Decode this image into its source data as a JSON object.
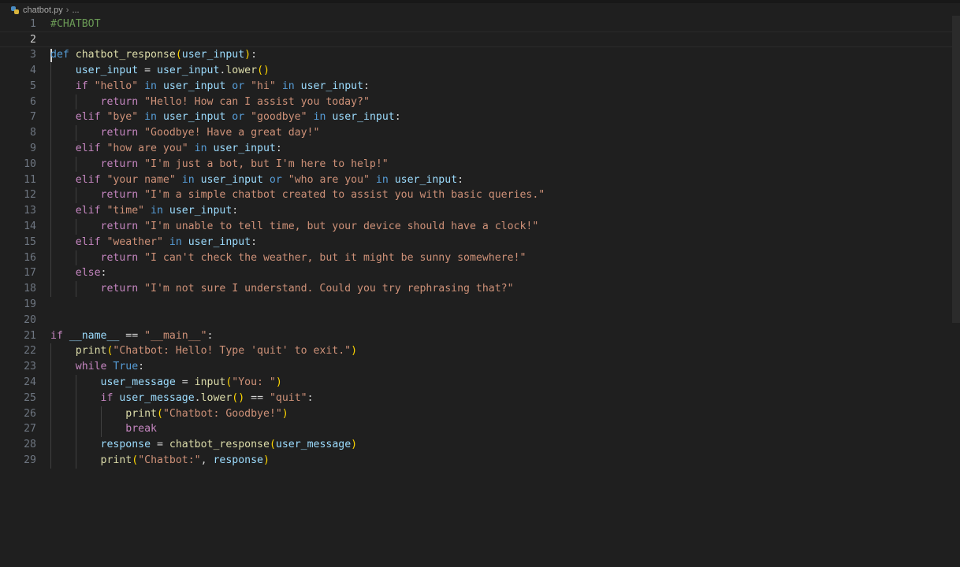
{
  "breadcrumb": {
    "file": "chatbot.py",
    "separator": "›",
    "more": "..."
  },
  "editor": {
    "active_line": 2,
    "lines": [
      {
        "n": "1",
        "tokens": [
          {
            "t": "#CHATBOT",
            "c": "cm"
          }
        ]
      },
      {
        "n": "2",
        "tokens": []
      },
      {
        "n": "3",
        "tokens": [
          {
            "t": "def ",
            "c": "kw2"
          },
          {
            "t": "chatbot_response",
            "c": "fn"
          },
          {
            "t": "(",
            "c": "p1"
          },
          {
            "t": "user_input",
            "c": "var"
          },
          {
            "t": ")",
            "c": "p1"
          },
          {
            "t": ":",
            "c": ""
          }
        ]
      },
      {
        "n": "4",
        "tokens": [
          {
            "t": "    ",
            "c": ""
          },
          {
            "t": "user_input",
            "c": "var"
          },
          {
            "t": " = ",
            "c": ""
          },
          {
            "t": "user_input",
            "c": "var"
          },
          {
            "t": ".",
            "c": ""
          },
          {
            "t": "lower",
            "c": "fn"
          },
          {
            "t": "()",
            "c": "p1"
          }
        ]
      },
      {
        "n": "5",
        "tokens": [
          {
            "t": "    ",
            "c": ""
          },
          {
            "t": "if ",
            "c": "kw"
          },
          {
            "t": "\"hello\"",
            "c": "str"
          },
          {
            "t": " in ",
            "c": "kw2"
          },
          {
            "t": "user_input",
            "c": "var"
          },
          {
            "t": " or ",
            "c": "kw2"
          },
          {
            "t": "\"hi\"",
            "c": "str"
          },
          {
            "t": " in ",
            "c": "kw2"
          },
          {
            "t": "user_input",
            "c": "var"
          },
          {
            "t": ":",
            "c": ""
          }
        ]
      },
      {
        "n": "6",
        "tokens": [
          {
            "t": "        ",
            "c": ""
          },
          {
            "t": "return ",
            "c": "kw"
          },
          {
            "t": "\"Hello! How can I assist you today?\"",
            "c": "str"
          }
        ]
      },
      {
        "n": "7",
        "tokens": [
          {
            "t": "    ",
            "c": ""
          },
          {
            "t": "elif ",
            "c": "kw"
          },
          {
            "t": "\"bye\"",
            "c": "str"
          },
          {
            "t": " in ",
            "c": "kw2"
          },
          {
            "t": "user_input",
            "c": "var"
          },
          {
            "t": " or ",
            "c": "kw2"
          },
          {
            "t": "\"goodbye\"",
            "c": "str"
          },
          {
            "t": " in ",
            "c": "kw2"
          },
          {
            "t": "user_input",
            "c": "var"
          },
          {
            "t": ":",
            "c": ""
          }
        ]
      },
      {
        "n": "8",
        "tokens": [
          {
            "t": "        ",
            "c": ""
          },
          {
            "t": "return ",
            "c": "kw"
          },
          {
            "t": "\"Goodbye! Have a great day!\"",
            "c": "str"
          }
        ]
      },
      {
        "n": "9",
        "tokens": [
          {
            "t": "    ",
            "c": ""
          },
          {
            "t": "elif ",
            "c": "kw"
          },
          {
            "t": "\"how are you\"",
            "c": "str"
          },
          {
            "t": " in ",
            "c": "kw2"
          },
          {
            "t": "user_input",
            "c": "var"
          },
          {
            "t": ":",
            "c": ""
          }
        ]
      },
      {
        "n": "10",
        "tokens": [
          {
            "t": "        ",
            "c": ""
          },
          {
            "t": "return ",
            "c": "kw"
          },
          {
            "t": "\"I'm just a bot, but I'm here to help!\"",
            "c": "str"
          }
        ]
      },
      {
        "n": "11",
        "tokens": [
          {
            "t": "    ",
            "c": ""
          },
          {
            "t": "elif ",
            "c": "kw"
          },
          {
            "t": "\"your name\"",
            "c": "str"
          },
          {
            "t": " in ",
            "c": "kw2"
          },
          {
            "t": "user_input",
            "c": "var"
          },
          {
            "t": " or ",
            "c": "kw2"
          },
          {
            "t": "\"who are you\"",
            "c": "str"
          },
          {
            "t": " in ",
            "c": "kw2"
          },
          {
            "t": "user_input",
            "c": "var"
          },
          {
            "t": ":",
            "c": ""
          }
        ]
      },
      {
        "n": "12",
        "tokens": [
          {
            "t": "        ",
            "c": ""
          },
          {
            "t": "return ",
            "c": "kw"
          },
          {
            "t": "\"I'm a simple chatbot created to assist you with basic queries.\"",
            "c": "str"
          }
        ]
      },
      {
        "n": "13",
        "tokens": [
          {
            "t": "    ",
            "c": ""
          },
          {
            "t": "elif ",
            "c": "kw"
          },
          {
            "t": "\"time\"",
            "c": "str"
          },
          {
            "t": " in ",
            "c": "kw2"
          },
          {
            "t": "user_input",
            "c": "var"
          },
          {
            "t": ":",
            "c": ""
          }
        ]
      },
      {
        "n": "14",
        "tokens": [
          {
            "t": "        ",
            "c": ""
          },
          {
            "t": "return ",
            "c": "kw"
          },
          {
            "t": "\"I'm unable to tell time, but your device should have a clock!\"",
            "c": "str"
          }
        ]
      },
      {
        "n": "15",
        "tokens": [
          {
            "t": "    ",
            "c": ""
          },
          {
            "t": "elif ",
            "c": "kw"
          },
          {
            "t": "\"weather\"",
            "c": "str"
          },
          {
            "t": " in ",
            "c": "kw2"
          },
          {
            "t": "user_input",
            "c": "var"
          },
          {
            "t": ":",
            "c": ""
          }
        ]
      },
      {
        "n": "16",
        "tokens": [
          {
            "t": "        ",
            "c": ""
          },
          {
            "t": "return ",
            "c": "kw"
          },
          {
            "t": "\"I can't check the weather, but it might be sunny somewhere!\"",
            "c": "str"
          }
        ]
      },
      {
        "n": "17",
        "tokens": [
          {
            "t": "    ",
            "c": ""
          },
          {
            "t": "else",
            "c": "kw"
          },
          {
            "t": ":",
            "c": ""
          }
        ]
      },
      {
        "n": "18",
        "tokens": [
          {
            "t": "        ",
            "c": ""
          },
          {
            "t": "return ",
            "c": "kw"
          },
          {
            "t": "\"I'm not sure I understand. Could you try rephrasing that?\"",
            "c": "str"
          }
        ]
      },
      {
        "n": "19",
        "tokens": []
      },
      {
        "n": "20",
        "tokens": []
      },
      {
        "n": "21",
        "tokens": [
          {
            "t": "if ",
            "c": "kw"
          },
          {
            "t": "__name__",
            "c": "var"
          },
          {
            "t": " == ",
            "c": ""
          },
          {
            "t": "\"__main__\"",
            "c": "str"
          },
          {
            "t": ":",
            "c": ""
          }
        ]
      },
      {
        "n": "22",
        "tokens": [
          {
            "t": "    ",
            "c": ""
          },
          {
            "t": "print",
            "c": "fn"
          },
          {
            "t": "(",
            "c": "p1"
          },
          {
            "t": "\"Chatbot: Hello! Type 'quit' to exit.\"",
            "c": "str"
          },
          {
            "t": ")",
            "c": "p1"
          }
        ]
      },
      {
        "n": "23",
        "tokens": [
          {
            "t": "    ",
            "c": ""
          },
          {
            "t": "while ",
            "c": "kw"
          },
          {
            "t": "True",
            "c": "kw2"
          },
          {
            "t": ":",
            "c": ""
          }
        ]
      },
      {
        "n": "24",
        "tokens": [
          {
            "t": "        ",
            "c": ""
          },
          {
            "t": "user_message",
            "c": "var"
          },
          {
            "t": " = ",
            "c": ""
          },
          {
            "t": "input",
            "c": "fn"
          },
          {
            "t": "(",
            "c": "p1"
          },
          {
            "t": "\"You: \"",
            "c": "str"
          },
          {
            "t": ")",
            "c": "p1"
          }
        ]
      },
      {
        "n": "25",
        "tokens": [
          {
            "t": "        ",
            "c": ""
          },
          {
            "t": "if ",
            "c": "kw"
          },
          {
            "t": "user_message",
            "c": "var"
          },
          {
            "t": ".",
            "c": ""
          },
          {
            "t": "lower",
            "c": "fn"
          },
          {
            "t": "()",
            "c": "p1"
          },
          {
            "t": " == ",
            "c": ""
          },
          {
            "t": "\"quit\"",
            "c": "str"
          },
          {
            "t": ":",
            "c": ""
          }
        ]
      },
      {
        "n": "26",
        "tokens": [
          {
            "t": "            ",
            "c": ""
          },
          {
            "t": "print",
            "c": "fn"
          },
          {
            "t": "(",
            "c": "p1"
          },
          {
            "t": "\"Chatbot: Goodbye!\"",
            "c": "str"
          },
          {
            "t": ")",
            "c": "p1"
          }
        ]
      },
      {
        "n": "27",
        "tokens": [
          {
            "t": "            ",
            "c": ""
          },
          {
            "t": "break",
            "c": "kw"
          }
        ]
      },
      {
        "n": "28",
        "tokens": [
          {
            "t": "        ",
            "c": ""
          },
          {
            "t": "response",
            "c": "var"
          },
          {
            "t": " = ",
            "c": ""
          },
          {
            "t": "chatbot_response",
            "c": "fn"
          },
          {
            "t": "(",
            "c": "p1"
          },
          {
            "t": "user_message",
            "c": "var"
          },
          {
            "t": ")",
            "c": "p1"
          }
        ]
      },
      {
        "n": "29",
        "tokens": [
          {
            "t": "        ",
            "c": ""
          },
          {
            "t": "print",
            "c": "fn"
          },
          {
            "t": "(",
            "c": "p1"
          },
          {
            "t": "\"Chatbot:\"",
            "c": "str"
          },
          {
            "t": ", ",
            "c": ""
          },
          {
            "t": "response",
            "c": "var"
          },
          {
            "t": ")",
            "c": "p1"
          }
        ]
      }
    ]
  }
}
